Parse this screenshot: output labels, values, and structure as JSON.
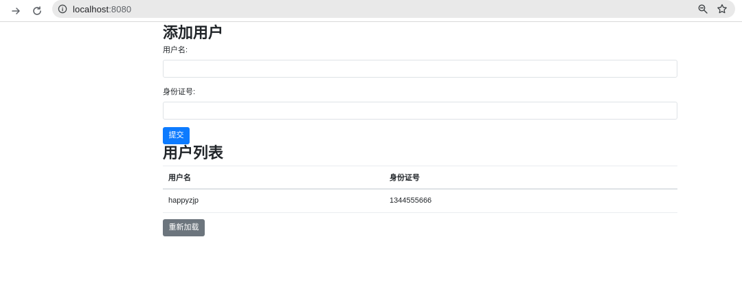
{
  "browser": {
    "url_host": "localhost",
    "url_port": ":8080"
  },
  "add_form": {
    "title": "添加用户",
    "username_label": "用户名:",
    "username_value": "",
    "idcard_label": "身份证号:",
    "idcard_value": "",
    "submit_label": "提交"
  },
  "user_list": {
    "title": "用户列表",
    "columns": [
      "用户名",
      "身份证号"
    ],
    "rows": [
      {
        "username": "happyzjp",
        "idcard": "1344555666"
      }
    ],
    "reload_label": "重新加载"
  },
  "colors": {
    "primary": "#0d7bff",
    "secondary": "#6c757d"
  }
}
